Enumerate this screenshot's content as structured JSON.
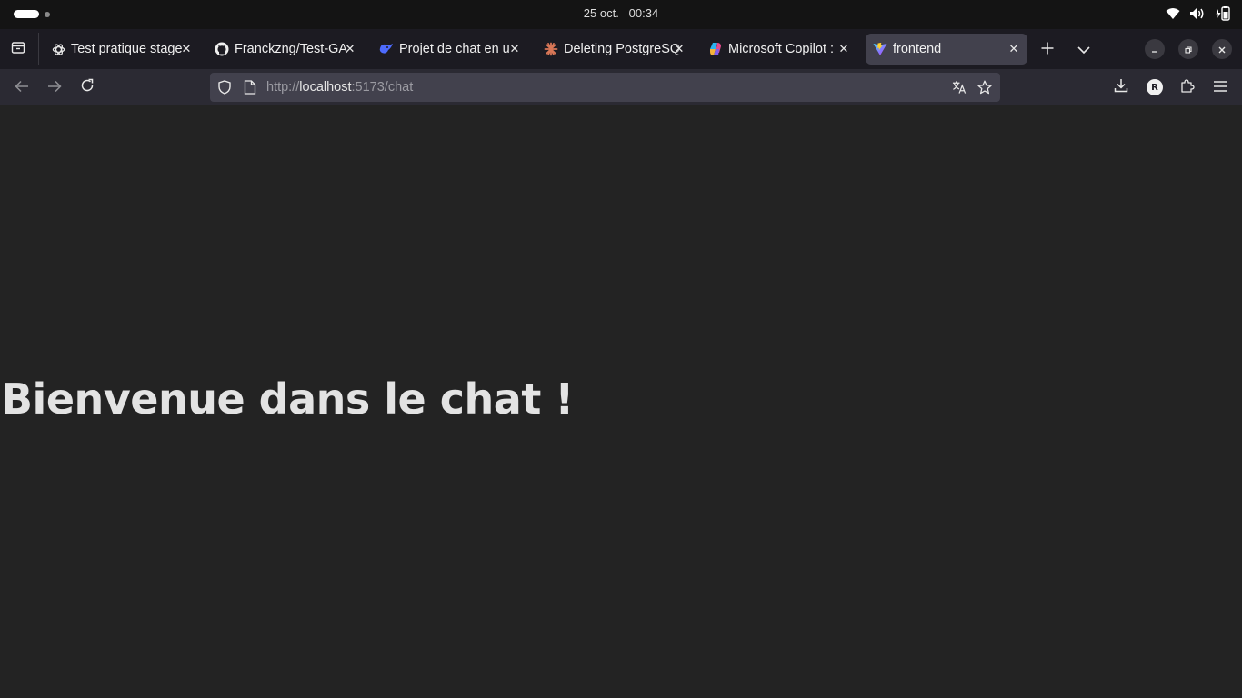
{
  "system_bar": {
    "clock_date": "25 oct.",
    "clock_time": "00:34"
  },
  "tabs": [
    {
      "title": "Test pratique stage",
      "icon": "openai-icon",
      "active": false
    },
    {
      "title": "Franckzng/Test-GA",
      "icon": "github-icon",
      "active": false
    },
    {
      "title": "Projet de chat en u",
      "icon": "deepseek-icon",
      "active": false
    },
    {
      "title": "Deleting PostgreSQ",
      "icon": "claude-icon",
      "active": false
    },
    {
      "title": "Microsoft Copilot :",
      "icon": "copilot-icon",
      "active": false
    },
    {
      "title": "frontend",
      "icon": "vite-icon",
      "active": true
    }
  ],
  "url": {
    "scheme": "http://",
    "host": "localhost",
    "rest": ":5173/chat"
  },
  "profile": {
    "initial": "R"
  },
  "page": {
    "heading": "Bienvenue dans le chat !"
  },
  "colors": {
    "page_bg": "#232323",
    "toolbar_bg": "#2b2a33",
    "tabstrip_bg": "#1c1b22",
    "active_tab_bg": "#42414d",
    "system_bar_bg": "#141414"
  }
}
